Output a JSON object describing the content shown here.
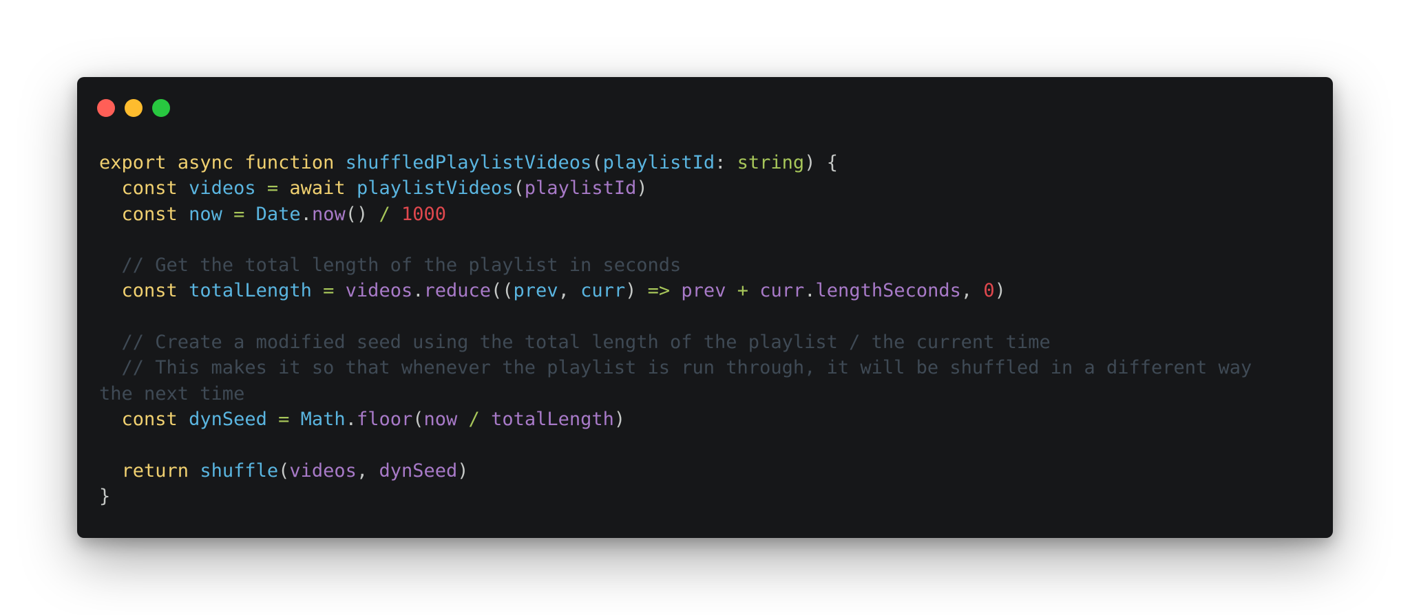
{
  "window": {
    "controls": [
      {
        "name": "close-dot",
        "color": "#ff5f57"
      },
      {
        "name": "minimize-dot",
        "color": "#febc2e"
      },
      {
        "name": "maximize-dot",
        "color": "#28c840"
      }
    ]
  },
  "palette": {
    "kw": "#f0d070",
    "fn": "#5ab5e0",
    "param": "#5ab5e0",
    "type": "#a7c65a",
    "op": "#a7c65a",
    "var": "#a87ac8",
    "num": "#e0484e",
    "comment": "#3f4a55",
    "plain": "#c5c8c6"
  },
  "code": {
    "lines": [
      [
        {
          "t": "export",
          "c": "kw"
        },
        {
          "t": " ",
          "c": "plain"
        },
        {
          "t": "async",
          "c": "kw"
        },
        {
          "t": " ",
          "c": "plain"
        },
        {
          "t": "function",
          "c": "kw"
        },
        {
          "t": " ",
          "c": "plain"
        },
        {
          "t": "shuffledPlaylistVideos",
          "c": "fn"
        },
        {
          "t": "(",
          "c": "plain"
        },
        {
          "t": "playlistId",
          "c": "param"
        },
        {
          "t": ": ",
          "c": "plain"
        },
        {
          "t": "string",
          "c": "type"
        },
        {
          "t": ") {",
          "c": "plain"
        }
      ],
      [
        {
          "t": "  ",
          "c": "plain"
        },
        {
          "t": "const",
          "c": "kw"
        },
        {
          "t": " ",
          "c": "plain"
        },
        {
          "t": "videos",
          "c": "fn"
        },
        {
          "t": " ",
          "c": "plain"
        },
        {
          "t": "=",
          "c": "op"
        },
        {
          "t": " ",
          "c": "plain"
        },
        {
          "t": "await",
          "c": "kw"
        },
        {
          "t": " ",
          "c": "plain"
        },
        {
          "t": "playlistVideos",
          "c": "fn"
        },
        {
          "t": "(",
          "c": "plain"
        },
        {
          "t": "playlistId",
          "c": "var"
        },
        {
          "t": ")",
          "c": "plain"
        }
      ],
      [
        {
          "t": "  ",
          "c": "plain"
        },
        {
          "t": "const",
          "c": "kw"
        },
        {
          "t": " ",
          "c": "plain"
        },
        {
          "t": "now",
          "c": "fn"
        },
        {
          "t": " ",
          "c": "plain"
        },
        {
          "t": "=",
          "c": "op"
        },
        {
          "t": " ",
          "c": "plain"
        },
        {
          "t": "Date",
          "c": "fn"
        },
        {
          "t": ".",
          "c": "plain"
        },
        {
          "t": "now",
          "c": "var"
        },
        {
          "t": "() ",
          "c": "plain"
        },
        {
          "t": "/",
          "c": "op"
        },
        {
          "t": " ",
          "c": "plain"
        },
        {
          "t": "1000",
          "c": "num"
        }
      ],
      [],
      [
        {
          "t": "  // Get the total length of the playlist in seconds",
          "c": "comment"
        }
      ],
      [
        {
          "t": "  ",
          "c": "plain"
        },
        {
          "t": "const",
          "c": "kw"
        },
        {
          "t": " ",
          "c": "plain"
        },
        {
          "t": "totalLength",
          "c": "fn"
        },
        {
          "t": " ",
          "c": "plain"
        },
        {
          "t": "=",
          "c": "op"
        },
        {
          "t": " ",
          "c": "plain"
        },
        {
          "t": "videos",
          "c": "var"
        },
        {
          "t": ".",
          "c": "plain"
        },
        {
          "t": "reduce",
          "c": "var"
        },
        {
          "t": "((",
          "c": "plain"
        },
        {
          "t": "prev",
          "c": "param"
        },
        {
          "t": ", ",
          "c": "plain"
        },
        {
          "t": "curr",
          "c": "param"
        },
        {
          "t": ") ",
          "c": "plain"
        },
        {
          "t": "=>",
          "c": "op"
        },
        {
          "t": " ",
          "c": "plain"
        },
        {
          "t": "prev",
          "c": "var"
        },
        {
          "t": " ",
          "c": "plain"
        },
        {
          "t": "+",
          "c": "op"
        },
        {
          "t": " ",
          "c": "plain"
        },
        {
          "t": "curr",
          "c": "var"
        },
        {
          "t": ".",
          "c": "plain"
        },
        {
          "t": "lengthSeconds",
          "c": "var"
        },
        {
          "t": ", ",
          "c": "plain"
        },
        {
          "t": "0",
          "c": "num"
        },
        {
          "t": ")",
          "c": "plain"
        }
      ],
      [],
      [
        {
          "t": "  // Create a modified seed using the total length of the playlist / the current time",
          "c": "comment"
        }
      ],
      [
        {
          "t": "  // This makes it so that whenever the playlist is run through, it will be shuffled in a different way",
          "c": "comment"
        }
      ],
      [
        {
          "t": "the next time",
          "c": "comment"
        }
      ],
      [
        {
          "t": "  ",
          "c": "plain"
        },
        {
          "t": "const",
          "c": "kw"
        },
        {
          "t": " ",
          "c": "plain"
        },
        {
          "t": "dynSeed",
          "c": "fn"
        },
        {
          "t": " ",
          "c": "plain"
        },
        {
          "t": "=",
          "c": "op"
        },
        {
          "t": " ",
          "c": "plain"
        },
        {
          "t": "Math",
          "c": "fn"
        },
        {
          "t": ".",
          "c": "plain"
        },
        {
          "t": "floor",
          "c": "var"
        },
        {
          "t": "(",
          "c": "plain"
        },
        {
          "t": "now",
          "c": "var"
        },
        {
          "t": " ",
          "c": "plain"
        },
        {
          "t": "/",
          "c": "op"
        },
        {
          "t": " ",
          "c": "plain"
        },
        {
          "t": "totalLength",
          "c": "var"
        },
        {
          "t": ")",
          "c": "plain"
        }
      ],
      [],
      [
        {
          "t": "  ",
          "c": "plain"
        },
        {
          "t": "return",
          "c": "kw"
        },
        {
          "t": " ",
          "c": "plain"
        },
        {
          "t": "shuffle",
          "c": "fn"
        },
        {
          "t": "(",
          "c": "plain"
        },
        {
          "t": "videos",
          "c": "var"
        },
        {
          "t": ", ",
          "c": "plain"
        },
        {
          "t": "dynSeed",
          "c": "var"
        },
        {
          "t": ")",
          "c": "plain"
        }
      ],
      [
        {
          "t": "}",
          "c": "plain"
        }
      ]
    ]
  }
}
